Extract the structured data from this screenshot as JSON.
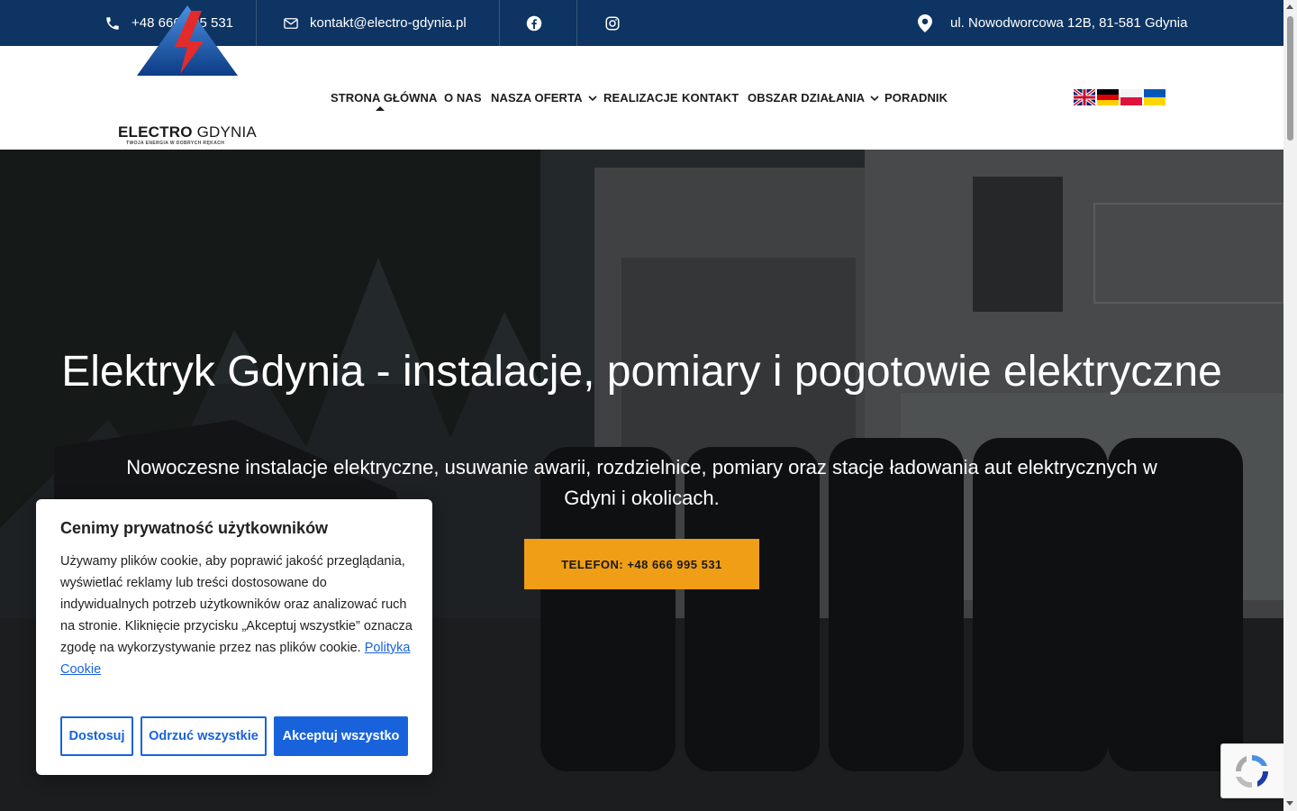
{
  "topbar": {
    "phone": "+48 666 995 531",
    "email": "kontakt@electro-gdynia.pl",
    "address": "ul. Nowodworcowa 12B, 81-581 Gdynia",
    "icons": [
      "phone-icon",
      "envelope-icon",
      "facebook-icon",
      "instagram-icon",
      "map-pin-icon"
    ]
  },
  "logo": {
    "name_bold": "ELECTRO",
    "name_light": "GDYNIA",
    "tagline": "TWOJA ENERGIA W DOBRYCH RĘKACH"
  },
  "nav": {
    "items": [
      {
        "label": "STRONA GŁÓWNA",
        "active": true
      },
      {
        "label": "O NAS"
      },
      {
        "label": "NASZA OFERTA",
        "dropdown": true
      },
      {
        "label": "REALIZACJE"
      },
      {
        "label": "KONTAKT"
      },
      {
        "label": "OBSZAR DZIAŁANIA",
        "dropdown": true
      },
      {
        "label": "PORADNIK"
      }
    ]
  },
  "languages": [
    "en",
    "de",
    "pl",
    "uk"
  ],
  "hero": {
    "title": "Elektryk Gdynia - instalacje, pomiary i pogotowie elektryczne",
    "subtitle": "Nowoczesne instalacje elektryczne, usuwanie awarii, rozdzielnice, pomiary oraz stacje ładowania aut elektrycznych w Gdyni i okolicach.",
    "cta": "TELEFON: +48 666 995 531"
  },
  "cookie": {
    "title": "Cenimy prywatność użytkowników",
    "body": "Używamy plików cookie, aby poprawić jakość przeglądania, wyświetlać reklamy lub treści dostosowane do indywidualnych potrzeb użytkowników oraz analizować ruch na stronie. Kliknięcie przycisku „Akceptuj wszystkie” oznacza zgodę na wykorzystywanie przez nas plików cookie.",
    "policy_link": "Polityka Cookie",
    "btn_customize": "Dostosuj",
    "btn_reject": "Odrzuć wszystkie",
    "btn_accept": "Akceptuj wszystko"
  },
  "colors": {
    "topbar": "#0d3462",
    "cta": "#ef9e16",
    "cookie_accent": "#1863dc"
  }
}
